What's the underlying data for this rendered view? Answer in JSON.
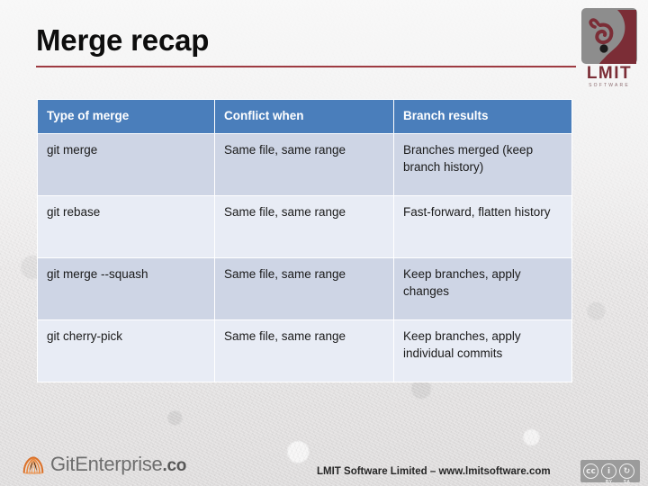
{
  "slide": {
    "title": "Merge recap"
  },
  "brand_logo": {
    "name": "LMIT",
    "tagline": "SOFTWARE"
  },
  "table": {
    "headers": [
      "Type of merge",
      "Conflict when",
      "Branch results"
    ],
    "rows": [
      {
        "type": "git merge",
        "conflict": "Same file, same range",
        "result": "Branches merged (keep branch history)"
      },
      {
        "type": "git rebase",
        "conflict": "Same file, same range",
        "result": "Fast-forward, flatten history"
      },
      {
        "type": "git merge --squash",
        "conflict": "Same file, same range",
        "result": "Keep branches, apply changes"
      },
      {
        "type": "git cherry-pick",
        "conflict": "Same file, same range",
        "result": "Keep branches, apply individual commits"
      }
    ]
  },
  "footer": {
    "product_name": "GitEnterprise",
    "product_tld": ".co",
    "credit": "LMIT Software Limited – www.lmitsoftware.com",
    "license": {
      "cc": "cc",
      "by_glyph": "ƒ",
      "sa_glyph": "⥁",
      "by_tag": "BY",
      "sa_tag": "SA"
    }
  },
  "colors": {
    "header_blue": "#4a7ebb",
    "row_dark": "#ced5e5",
    "row_light": "#e8ecf5",
    "accent_rule": "#9e3b42",
    "brand_maroon": "#7b2d36",
    "git_orange": "#e8853a"
  }
}
